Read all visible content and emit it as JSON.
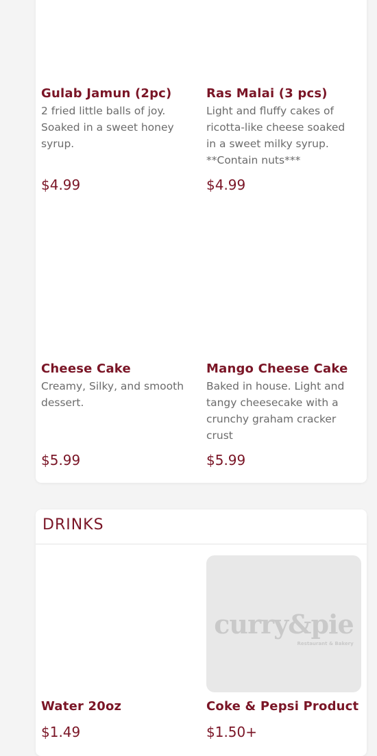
{
  "desserts": {
    "items": [
      {
        "name": "Gulab Jamun (2pc)",
        "description": "2 fried little balls of joy. Soaked in a sweet honey syrup.",
        "price": "$4.99"
      },
      {
        "name": "Ras Malai (3 pcs)",
        "description": "Light and fluffy cakes of ricotta-like cheese soaked in a sweet milky syrup. **Contain nuts***",
        "price": "$4.99"
      },
      {
        "name": "Cheese Cake",
        "description": "Creamy, Silky, and smooth dessert.",
        "price": "$5.99"
      },
      {
        "name": "Mango Cheese Cake",
        "description": "Baked in house. Light and tangy cheesecake with a crunchy graham cracker crust",
        "price": "$5.99"
      }
    ]
  },
  "drinks": {
    "title": "DRINKS",
    "items": [
      {
        "name": "Water 20oz",
        "price": "$1.49"
      },
      {
        "name": "Coke & Pepsi Product",
        "price": "$1.50+",
        "logo_text": "curry&pie",
        "logo_subtext": "Restaurant & Bakery"
      }
    ]
  },
  "colors": {
    "accent": "#7a1526",
    "text_muted": "#6b6b6b",
    "page_bg": "#f4f4f4",
    "card_bg": "#ffffff",
    "placeholder_bg": "#e8e8e8"
  }
}
